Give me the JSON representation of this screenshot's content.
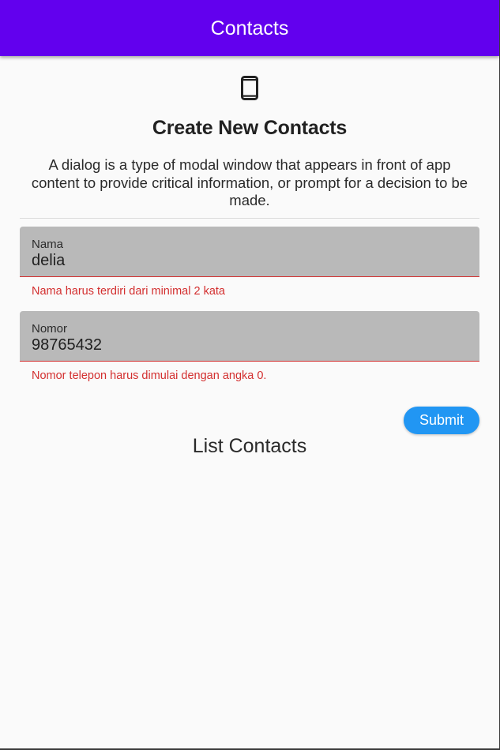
{
  "appbar": {
    "title": "Contacts"
  },
  "header": {
    "icon": "smartphone-icon",
    "heading": "Create New Contacts",
    "description": "A dialog is a type of modal window that appears in front of app content to provide critical information, or prompt for a decision to be made."
  },
  "form": {
    "name": {
      "label": "Nama",
      "value": "delia",
      "error": "Nama harus terdiri dari minimal 2 kata"
    },
    "phone": {
      "label": "Nomor",
      "value": "98765432",
      "error": "Nomor telepon harus dimulai dengan angka 0."
    },
    "submit_label": "Submit"
  },
  "list": {
    "title": "List Contacts"
  },
  "colors": {
    "appbar": "#6200ee",
    "error": "#d32f2f",
    "button": "#2196f3",
    "field_fill": "#b9b9b9"
  }
}
